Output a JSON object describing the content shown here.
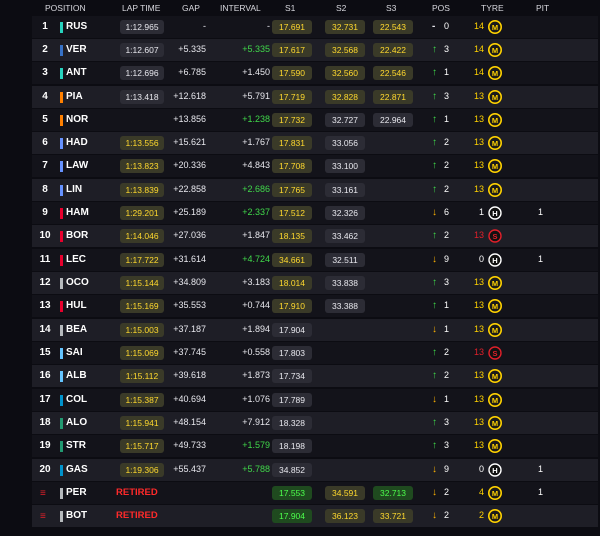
{
  "header": {
    "position": "POSITION",
    "lap_time": "LAP TIME",
    "gap": "GAP",
    "interval": "INTERVAL",
    "s1": "S1",
    "s2": "S2",
    "s3": "S3",
    "pos": "POS",
    "tyre": "TYRE",
    "pit": "PIT"
  },
  "colors": {
    "up": "#40d84a",
    "down": "#ffb400",
    "tyre_medium": "#ffd200",
    "tyre_soft": "#e0202a",
    "tyre_hard": "#ffffff",
    "retired": "#ff2a2a"
  },
  "rows": [
    {
      "pos": "1",
      "code": "RUS",
      "team_color": "#27d2be",
      "lap": "1:12.965",
      "lap_hl": false,
      "gap": "-",
      "interval": "-",
      "int_color": "#e8e8ee",
      "s1": "17.691",
      "s1c": "y",
      "s2": "32.731",
      "s2c": "y",
      "s3": "22.543",
      "s3c": "y",
      "arrow": "-",
      "pchg": "0",
      "tlaps": "14",
      "tlaps_color": "#ffd200",
      "tyre": "medium",
      "pit": ""
    },
    {
      "pos": "2",
      "code": "VER",
      "team_color": "#3671c6",
      "lap": "1:12.607",
      "lap_hl": false,
      "gap": "+5.335",
      "interval": "+5.335",
      "int_color": "#40d84a",
      "s1": "17.617",
      "s1c": "y",
      "s2": "32.568",
      "s2c": "y",
      "s3": "22.422",
      "s3c": "y",
      "arrow": "up",
      "pchg": "3",
      "tlaps": "14",
      "tlaps_color": "#ffd200",
      "tyre": "medium",
      "pit": ""
    },
    {
      "pos": "3",
      "code": "ANT",
      "team_color": "#27d2be",
      "lap": "1:12.696",
      "lap_hl": false,
      "gap": "+6.785",
      "interval": "+1.450",
      "int_color": "#e8e8ee",
      "s1": "17.590",
      "s1c": "y",
      "s2": "32.560",
      "s2c": "y",
      "s3": "22.546",
      "s3c": "y",
      "arrow": "up",
      "pchg": "1",
      "tlaps": "14",
      "tlaps_color": "#ffd200",
      "tyre": "medium",
      "pit": ""
    },
    {
      "pos": "4",
      "code": "PIA",
      "team_color": "#ff8000",
      "lap": "1:13.418",
      "lap_hl": false,
      "gap": "+12.618",
      "interval": "+5.791",
      "int_color": "#e8e8ee",
      "s1": "17.719",
      "s1c": "y",
      "s2": "32.828",
      "s2c": "y",
      "s3": "22.871",
      "s3c": "y",
      "arrow": "up",
      "pchg": "3",
      "tlaps": "13",
      "tlaps_color": "#ffd200",
      "tyre": "medium",
      "pit": ""
    },
    {
      "pos": "5",
      "code": "NOR",
      "team_color": "#ff8000",
      "lap": "",
      "lap_hl": false,
      "gap": "+13.856",
      "interval": "+1.238",
      "int_color": "#40d84a",
      "s1": "17.732",
      "s1c": "y",
      "s2": "32.727",
      "s2c": "w",
      "s3": "22.964",
      "s3c": "w",
      "arrow": "up",
      "pchg": "1",
      "tlaps": "13",
      "tlaps_color": "#ffd200",
      "tyre": "medium",
      "pit": ""
    },
    {
      "pos": "6",
      "code": "HAD",
      "team_color": "#6692ff",
      "lap": "1:13.556",
      "lap_hl": true,
      "gap": "+15.621",
      "interval": "+1.767",
      "int_color": "#e8e8ee",
      "s1": "17.831",
      "s1c": "y",
      "s2": "33.056",
      "s2c": "w",
      "s3": "",
      "s3c": "",
      "arrow": "up",
      "pchg": "2",
      "tlaps": "13",
      "tlaps_color": "#ffd200",
      "tyre": "medium",
      "pit": ""
    },
    {
      "pos": "7",
      "code": "LAW",
      "team_color": "#6692ff",
      "lap": "1:13.823",
      "lap_hl": true,
      "gap": "+20.336",
      "interval": "+4.843",
      "int_color": "#e8e8ee",
      "s1": "17.708",
      "s1c": "y",
      "s2": "33.100",
      "s2c": "w",
      "s3": "",
      "s3c": "",
      "arrow": "up",
      "pchg": "2",
      "tlaps": "13",
      "tlaps_color": "#ffd200",
      "tyre": "medium",
      "pit": ""
    },
    {
      "pos": "8",
      "code": "LIN",
      "team_color": "#6692ff",
      "lap": "1:13.839",
      "lap_hl": true,
      "gap": "+22.858",
      "interval": "+2.686",
      "int_color": "#40d84a",
      "s1": "17.765",
      "s1c": "y",
      "s2": "33.161",
      "s2c": "w",
      "s3": "",
      "s3c": "",
      "arrow": "up",
      "pchg": "2",
      "tlaps": "13",
      "tlaps_color": "#ffd200",
      "tyre": "medium",
      "pit": ""
    },
    {
      "pos": "9",
      "code": "HAM",
      "team_color": "#e8002d",
      "lap": "1:29.201",
      "lap_hl": true,
      "gap": "+25.189",
      "interval": "+2.337",
      "int_color": "#40d84a",
      "s1": "17.512",
      "s1c": "y",
      "s2": "32.326",
      "s2c": "w",
      "s3": "",
      "s3c": "",
      "arrow": "down",
      "pchg": "6",
      "tlaps": "1",
      "tlaps_color": "#ffffff",
      "tyre": "hard",
      "pit": "1"
    },
    {
      "pos": "10",
      "code": "BOR",
      "team_color": "#e8002d",
      "lap": "1:14.046",
      "lap_hl": true,
      "gap": "+27.036",
      "interval": "+1.847",
      "int_color": "#e8e8ee",
      "s1": "18.135",
      "s1c": "y",
      "s2": "33.462",
      "s2c": "w",
      "s3": "",
      "s3c": "",
      "arrow": "up",
      "pchg": "2",
      "tlaps": "13",
      "tlaps_color": "#e0202a",
      "tyre": "soft",
      "pit": ""
    },
    {
      "pos": "11",
      "code": "LEC",
      "team_color": "#e8002d",
      "lap": "1:17.722",
      "lap_hl": true,
      "gap": "+31.614",
      "interval": "+4.724",
      "int_color": "#40d84a",
      "s1": "34.661",
      "s1c": "y",
      "s2": "32.511",
      "s2c": "w",
      "s3": "",
      "s3c": "",
      "arrow": "down",
      "pchg": "9",
      "tlaps": "0",
      "tlaps_color": "#ffffff",
      "tyre": "hard",
      "pit": "1"
    },
    {
      "pos": "12",
      "code": "OCO",
      "team_color": "#b6babd",
      "lap": "1:15.144",
      "lap_hl": true,
      "gap": "+34.809",
      "interval": "+3.183",
      "int_color": "#e8e8ee",
      "s1": "18.014",
      "s1c": "y",
      "s2": "33.838",
      "s2c": "w",
      "s3": "",
      "s3c": "",
      "arrow": "up",
      "pchg": "3",
      "tlaps": "13",
      "tlaps_color": "#ffd200",
      "tyre": "medium",
      "pit": ""
    },
    {
      "pos": "13",
      "code": "HUL",
      "team_color": "#e8002d",
      "lap": "1:15.169",
      "lap_hl": true,
      "gap": "+35.553",
      "interval": "+0.744",
      "int_color": "#e8e8ee",
      "s1": "17.910",
      "s1c": "y",
      "s2": "33.388",
      "s2c": "w",
      "s3": "",
      "s3c": "",
      "arrow": "up",
      "pchg": "1",
      "tlaps": "13",
      "tlaps_color": "#ffd200",
      "tyre": "medium",
      "pit": ""
    },
    {
      "pos": "14",
      "code": "BEA",
      "team_color": "#b6babd",
      "lap": "1:15.003",
      "lap_hl": true,
      "gap": "+37.187",
      "interval": "+1.894",
      "int_color": "#e8e8ee",
      "s1": "17.904",
      "s1c": "w",
      "s2": "",
      "s2c": "",
      "s3": "",
      "s3c": "",
      "arrow": "down",
      "pchg": "1",
      "tlaps": "13",
      "tlaps_color": "#ffd200",
      "tyre": "medium",
      "pit": ""
    },
    {
      "pos": "15",
      "code": "SAI",
      "team_color": "#64c4ff",
      "lap": "1:15.069",
      "lap_hl": true,
      "gap": "+37.745",
      "interval": "+0.558",
      "int_color": "#e8e8ee",
      "s1": "17.803",
      "s1c": "w",
      "s2": "",
      "s2c": "",
      "s3": "",
      "s3c": "",
      "arrow": "up",
      "pchg": "2",
      "tlaps": "13",
      "tlaps_color": "#e0202a",
      "tyre": "soft",
      "pit": ""
    },
    {
      "pos": "16",
      "code": "ALB",
      "team_color": "#64c4ff",
      "lap": "1:15.112",
      "lap_hl": true,
      "gap": "+39.618",
      "interval": "+1.873",
      "int_color": "#e8e8ee",
      "s1": "17.734",
      "s1c": "w",
      "s2": "",
      "s2c": "",
      "s3": "",
      "s3c": "",
      "arrow": "up",
      "pchg": "2",
      "tlaps": "13",
      "tlaps_color": "#ffd200",
      "tyre": "medium",
      "pit": ""
    },
    {
      "pos": "17",
      "code": "COL",
      "team_color": "#0093cc",
      "lap": "1:15.387",
      "lap_hl": true,
      "gap": "+40.694",
      "interval": "+1.076",
      "int_color": "#e8e8ee",
      "s1": "17.789",
      "s1c": "w",
      "s2": "",
      "s2c": "",
      "s3": "",
      "s3c": "",
      "arrow": "down",
      "pchg": "1",
      "tlaps": "13",
      "tlaps_color": "#ffd200",
      "tyre": "medium",
      "pit": ""
    },
    {
      "pos": "18",
      "code": "ALO",
      "team_color": "#229971",
      "lap": "1:15.941",
      "lap_hl": true,
      "gap": "+48.154",
      "interval": "+7.912",
      "int_color": "#e8e8ee",
      "s1": "18.328",
      "s1c": "w",
      "s2": "",
      "s2c": "",
      "s3": "",
      "s3c": "",
      "arrow": "up",
      "pchg": "3",
      "tlaps": "13",
      "tlaps_color": "#ffd200",
      "tyre": "medium",
      "pit": ""
    },
    {
      "pos": "19",
      "code": "STR",
      "team_color": "#229971",
      "lap": "1:15.717",
      "lap_hl": true,
      "gap": "+49.733",
      "interval": "+1.579",
      "int_color": "#40d84a",
      "s1": "18.198",
      "s1c": "w",
      "s2": "",
      "s2c": "",
      "s3": "",
      "s3c": "",
      "arrow": "up",
      "pchg": "3",
      "tlaps": "13",
      "tlaps_color": "#ffd200",
      "tyre": "medium",
      "pit": ""
    },
    {
      "pos": "20",
      "code": "GAS",
      "team_color": "#0093cc",
      "lap": "1:19.306",
      "lap_hl": true,
      "gap": "+55.437",
      "interval": "+5.788",
      "int_color": "#40d84a",
      "s1": "34.852",
      "s1c": "w",
      "s2": "",
      "s2c": "",
      "s3": "",
      "s3c": "",
      "arrow": "down",
      "pchg": "9",
      "tlaps": "0",
      "tlaps_color": "#ffffff",
      "tyre": "hard",
      "pit": "1"
    },
    {
      "pos": "",
      "retired_icon": "≡",
      "code": "PER",
      "team_color": "#b6babd",
      "retired": "RETIRED",
      "lap": "",
      "gap": "",
      "interval": "",
      "int_color": "#e8e8ee",
      "s1": "17.553",
      "s1c": "g",
      "s2": "34.591",
      "s2c": "y",
      "s3": "32.713",
      "s3c": "g",
      "arrow": "down",
      "pchg": "2",
      "tlaps": "4",
      "tlaps_color": "#ffd200",
      "tyre": "medium",
      "pit": "1"
    },
    {
      "pos": "",
      "retired_icon": "≡",
      "code": "BOT",
      "team_color": "#b6babd",
      "retired": "RETIRED",
      "lap": "",
      "gap": "",
      "interval": "",
      "int_color": "#e8e8ee",
      "s1": "17.904",
      "s1c": "g",
      "s2": "36.123",
      "s2c": "y",
      "s3": "33.721",
      "s3c": "y",
      "arrow": "down",
      "pchg": "2",
      "tlaps": "2",
      "tlaps_color": "#ffd200",
      "tyre": "medium",
      "pit": ""
    }
  ]
}
